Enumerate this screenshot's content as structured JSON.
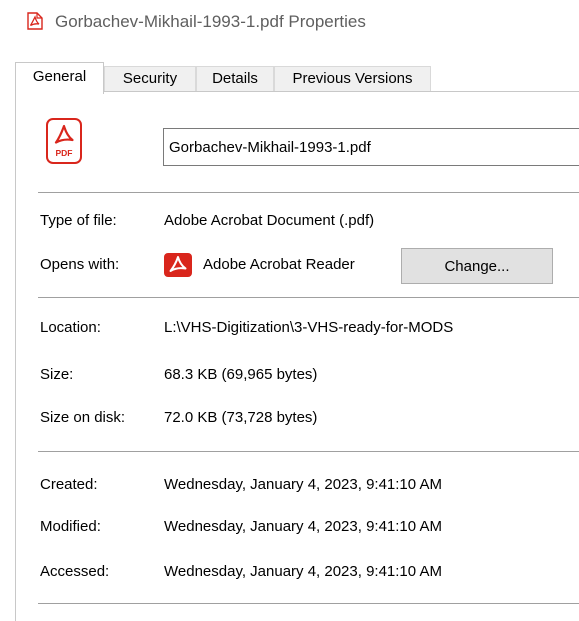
{
  "window": {
    "title": "Gorbachev-Mikhail-1993-1.pdf Properties",
    "icon": "pdf-file-icon"
  },
  "tabs": [
    {
      "label": "General",
      "active": true
    },
    {
      "label": "Security",
      "active": false
    },
    {
      "label": "Details",
      "active": false
    },
    {
      "label": "Previous Versions",
      "active": false
    }
  ],
  "general": {
    "file_icon": "pdf-document-icon",
    "file_icon_text": "PDF",
    "filename": "Gorbachev-Mikhail-1993-1.pdf",
    "type_label": "Type of file:",
    "type_value": "Adobe Acrobat Document (.pdf)",
    "opens_label": "Opens with:",
    "opens_app": "Adobe Acrobat Reader",
    "opens_app_icon": "acrobat-reader-icon",
    "change_button": "Change...",
    "location_label": "Location:",
    "location_value": "L:\\VHS-Digitization\\3-VHS-ready-for-MODS",
    "size_label": "Size:",
    "size_value": "68.3 KB (69,965 bytes)",
    "size_on_disk_label": "Size on disk:",
    "size_on_disk_value": "72.0 KB (73,728 bytes)",
    "created_label": "Created:",
    "created_value": "Wednesday, January 4, 2023, 9:41:10 AM",
    "modified_label": "Modified:",
    "modified_value": "Wednesday, January 4, 2023, 9:41:10 AM",
    "accessed_label": "Accessed:",
    "accessed_value": "Wednesday, January 4, 2023, 9:41:10 AM"
  },
  "colors": {
    "pdf_red": "#d9261c",
    "title_gray": "#5f5f5f",
    "separator": "#a0a0a0",
    "button_face": "#e1e1e1"
  }
}
